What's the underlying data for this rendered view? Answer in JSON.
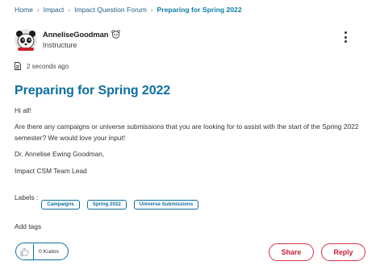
{
  "breadcrumb": {
    "items": [
      "Home",
      "Impact",
      "Impact Question Forum"
    ],
    "separator": "›",
    "current": "Preparing for Spring 2022"
  },
  "author": {
    "name": "AnneliseGoodman",
    "role": "Instructure",
    "avatar_icon": "panda-avatar-icon",
    "rank_icon": "panda-badge-icon"
  },
  "menu": {
    "icon": "kebab-menu-icon"
  },
  "post": {
    "timestamp": "2 seconds ago",
    "title": "Preparing for Spring 2022",
    "paragraphs": [
      "Hi all!",
      "Are there any campaigns or universe submissions that you are looking for to assist with the start of the Spring 2022 semester? We would love your input!",
      "Dr. Annelise Ewing Goodman,",
      "Impact CSM Team Lead"
    ]
  },
  "labels": {
    "caption": "Labels :",
    "items": [
      "Campaigns",
      "Spring 2022",
      "Universe Submissions"
    ]
  },
  "tags": {
    "add_label": "Add tags"
  },
  "kudos": {
    "count_label": "0 Kudos"
  },
  "actions": {
    "share_label": "Share",
    "reply_label": "Reply"
  },
  "colors": {
    "title": "#0d6fa0",
    "link": "#1f5f86",
    "accent_red": "#c61f3a",
    "pill_border": "#0d6fa0"
  }
}
